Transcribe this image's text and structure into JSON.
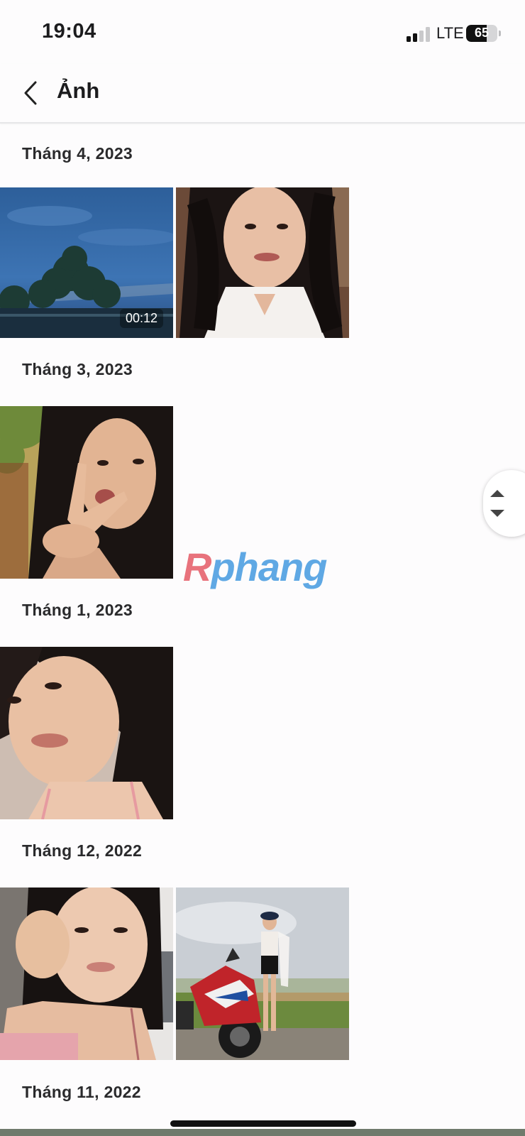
{
  "status_bar": {
    "time": "19:04",
    "network": "LTE",
    "battery": "65",
    "battery_level": 0.65
  },
  "header": {
    "title": "Ảnh"
  },
  "sections": [
    {
      "label": "Tháng 4, 2023",
      "items": [
        {
          "kind": "video",
          "duration": "00:12"
        },
        {
          "kind": "photo"
        }
      ]
    },
    {
      "label": "Tháng 3, 2023",
      "items": [
        {
          "kind": "photo"
        }
      ]
    },
    {
      "label": "Tháng 1, 2023",
      "items": [
        {
          "kind": "photo"
        }
      ]
    },
    {
      "label": "Tháng 12, 2022",
      "items": [
        {
          "kind": "photo"
        },
        {
          "kind": "photo"
        }
      ]
    },
    {
      "label": "Tháng 11, 2022",
      "items": []
    }
  ],
  "watermark": {
    "first": "R",
    "rest": "phang"
  },
  "icons": {
    "back": "chevron-left-icon",
    "scroll": "scroll-up-down-icon"
  },
  "colors": {
    "text": "#1c1c1e",
    "background": "#fdfcfd",
    "watermark_red": "#e8727c",
    "watermark_blue": "#5fa8e4"
  }
}
